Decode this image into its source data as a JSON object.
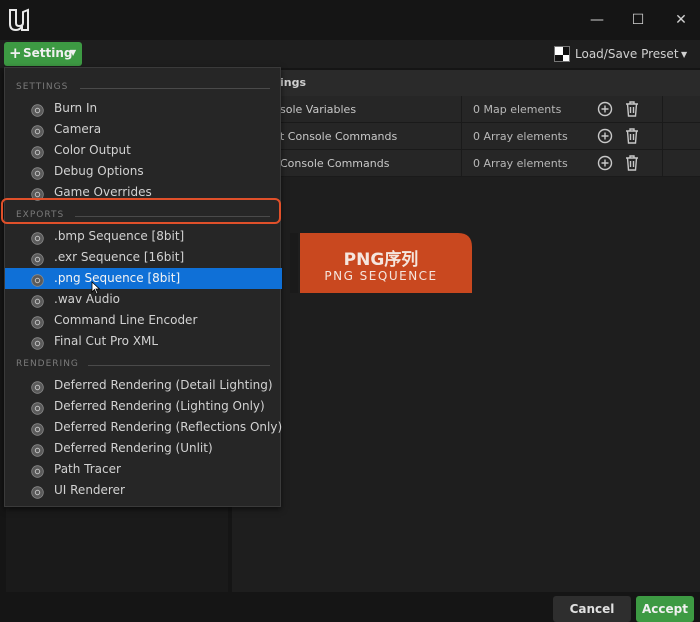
{
  "toolbar": {
    "setting_label": "Setting",
    "preset_label": "Load/Save Preset"
  },
  "right_panel": {
    "header_title": "ings",
    "rows": [
      {
        "name": "sole Variables",
        "value": "0 Map elements"
      },
      {
        "name": "t Console Commands",
        "value": "0 Array elements"
      },
      {
        "name": "Console Commands",
        "value": "0 Array elements"
      }
    ]
  },
  "badge": {
    "title": "PNG序列",
    "subtitle": "PNG SEQUENCE"
  },
  "menu": {
    "sections": [
      {
        "header": "SETTINGS",
        "items": [
          "Burn In",
          "Camera",
          "Color Output",
          "Debug Options",
          "Game Overrides"
        ]
      },
      {
        "header": "EXPORTS",
        "items": [
          ".bmp Sequence [8bit]",
          ".exr Sequence [16bit]",
          ".png Sequence [8bit]",
          ".wav Audio",
          "Command Line Encoder",
          "Final Cut Pro XML"
        ]
      },
      {
        "header": "RENDERING",
        "items": [
          "Deferred Rendering (Detail Lighting)",
          "Deferred Rendering (Lighting Only)",
          "Deferred Rendering (Reflections Only)",
          "Deferred Rendering (Unlit)",
          "Path Tracer",
          "UI Renderer"
        ]
      }
    ],
    "selected_item": ".png Sequence [8bit]"
  },
  "footer": {
    "cancel_label": "Cancel",
    "accept_label": "Accept"
  },
  "colors": {
    "accent_green": "#3d9a43",
    "selection_blue": "#0f70d7",
    "badge_orange": "#c9481f",
    "highlight_ring": "#e0502a"
  }
}
